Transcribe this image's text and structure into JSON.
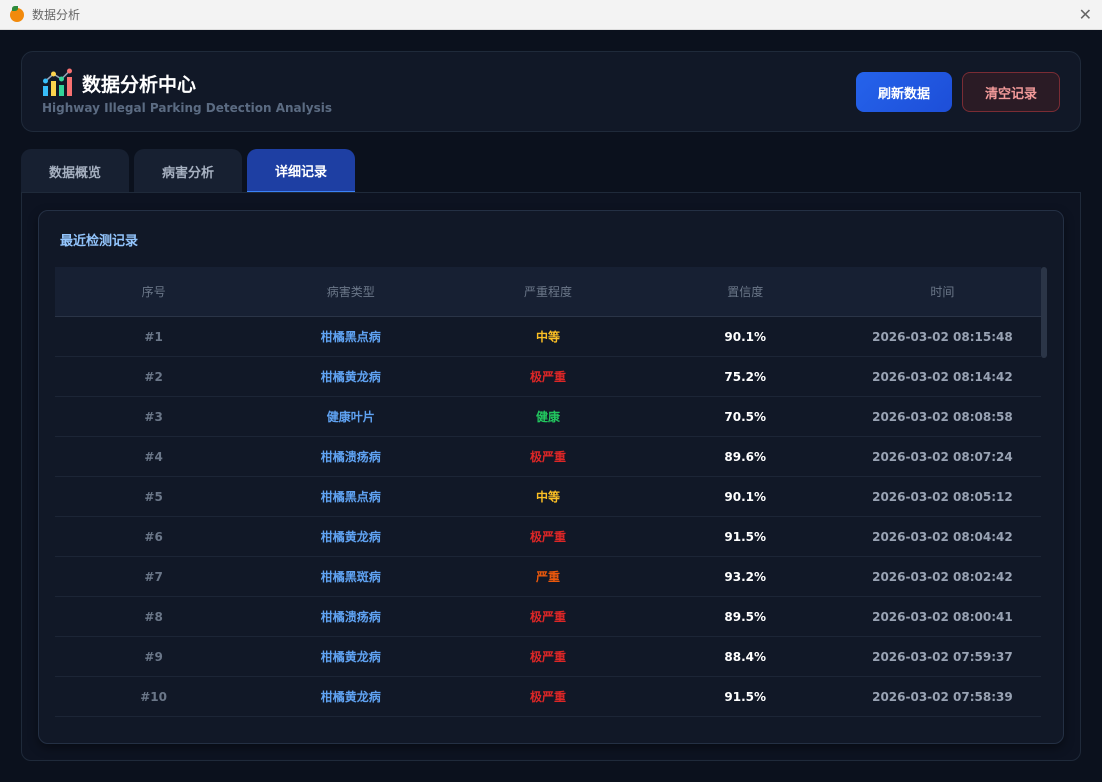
{
  "window": {
    "title": "数据分析",
    "close": "✕"
  },
  "header": {
    "title": "数据分析中心",
    "subtitle": "Highway Illegal Parking Detection Analysis",
    "refresh_label": "刷新数据",
    "clear_label": "清空记录"
  },
  "tabs": [
    {
      "label": "数据概览"
    },
    {
      "label": "病害分析"
    },
    {
      "label": "详细记录"
    }
  ],
  "records": {
    "title": "最近检测记录",
    "columns": [
      "序号",
      "病害类型",
      "严重程度",
      "置信度",
      "时间"
    ],
    "rows": [
      {
        "id": "#1",
        "type": "柑橘黑点病",
        "severity": "中等",
        "conf": "90.1%",
        "time": "2026-03-02 08:15:48"
      },
      {
        "id": "#2",
        "type": "柑橘黄龙病",
        "severity": "极严重",
        "conf": "75.2%",
        "time": "2026-03-02 08:14:42"
      },
      {
        "id": "#3",
        "type": "健康叶片",
        "severity": "健康",
        "conf": "70.5%",
        "time": "2026-03-02 08:08:58"
      },
      {
        "id": "#4",
        "type": "柑橘溃疡病",
        "severity": "极严重",
        "conf": "89.6%",
        "time": "2026-03-02 08:07:24"
      },
      {
        "id": "#5",
        "type": "柑橘黑点病",
        "severity": "中等",
        "conf": "90.1%",
        "time": "2026-03-02 08:05:12"
      },
      {
        "id": "#6",
        "type": "柑橘黄龙病",
        "severity": "极严重",
        "conf": "91.5%",
        "time": "2026-03-02 08:04:42"
      },
      {
        "id": "#7",
        "type": "柑橘黑斑病",
        "severity": "严重",
        "conf": "93.2%",
        "time": "2026-03-02 08:02:42"
      },
      {
        "id": "#8",
        "type": "柑橘溃疡病",
        "severity": "极严重",
        "conf": "89.5%",
        "time": "2026-03-02 08:00:41"
      },
      {
        "id": "#9",
        "type": "柑橘黄龙病",
        "severity": "极严重",
        "conf": "88.4%",
        "time": "2026-03-02 07:59:37"
      },
      {
        "id": "#10",
        "type": "柑橘黄龙病",
        "severity": "极严重",
        "conf": "91.5%",
        "time": "2026-03-02 07:58:39"
      }
    ]
  },
  "severity_colors": {
    "中等": "#fbbf24",
    "极严重": "#dc2626",
    "健康": "#22c55e",
    "严重": "#ea580c"
  }
}
